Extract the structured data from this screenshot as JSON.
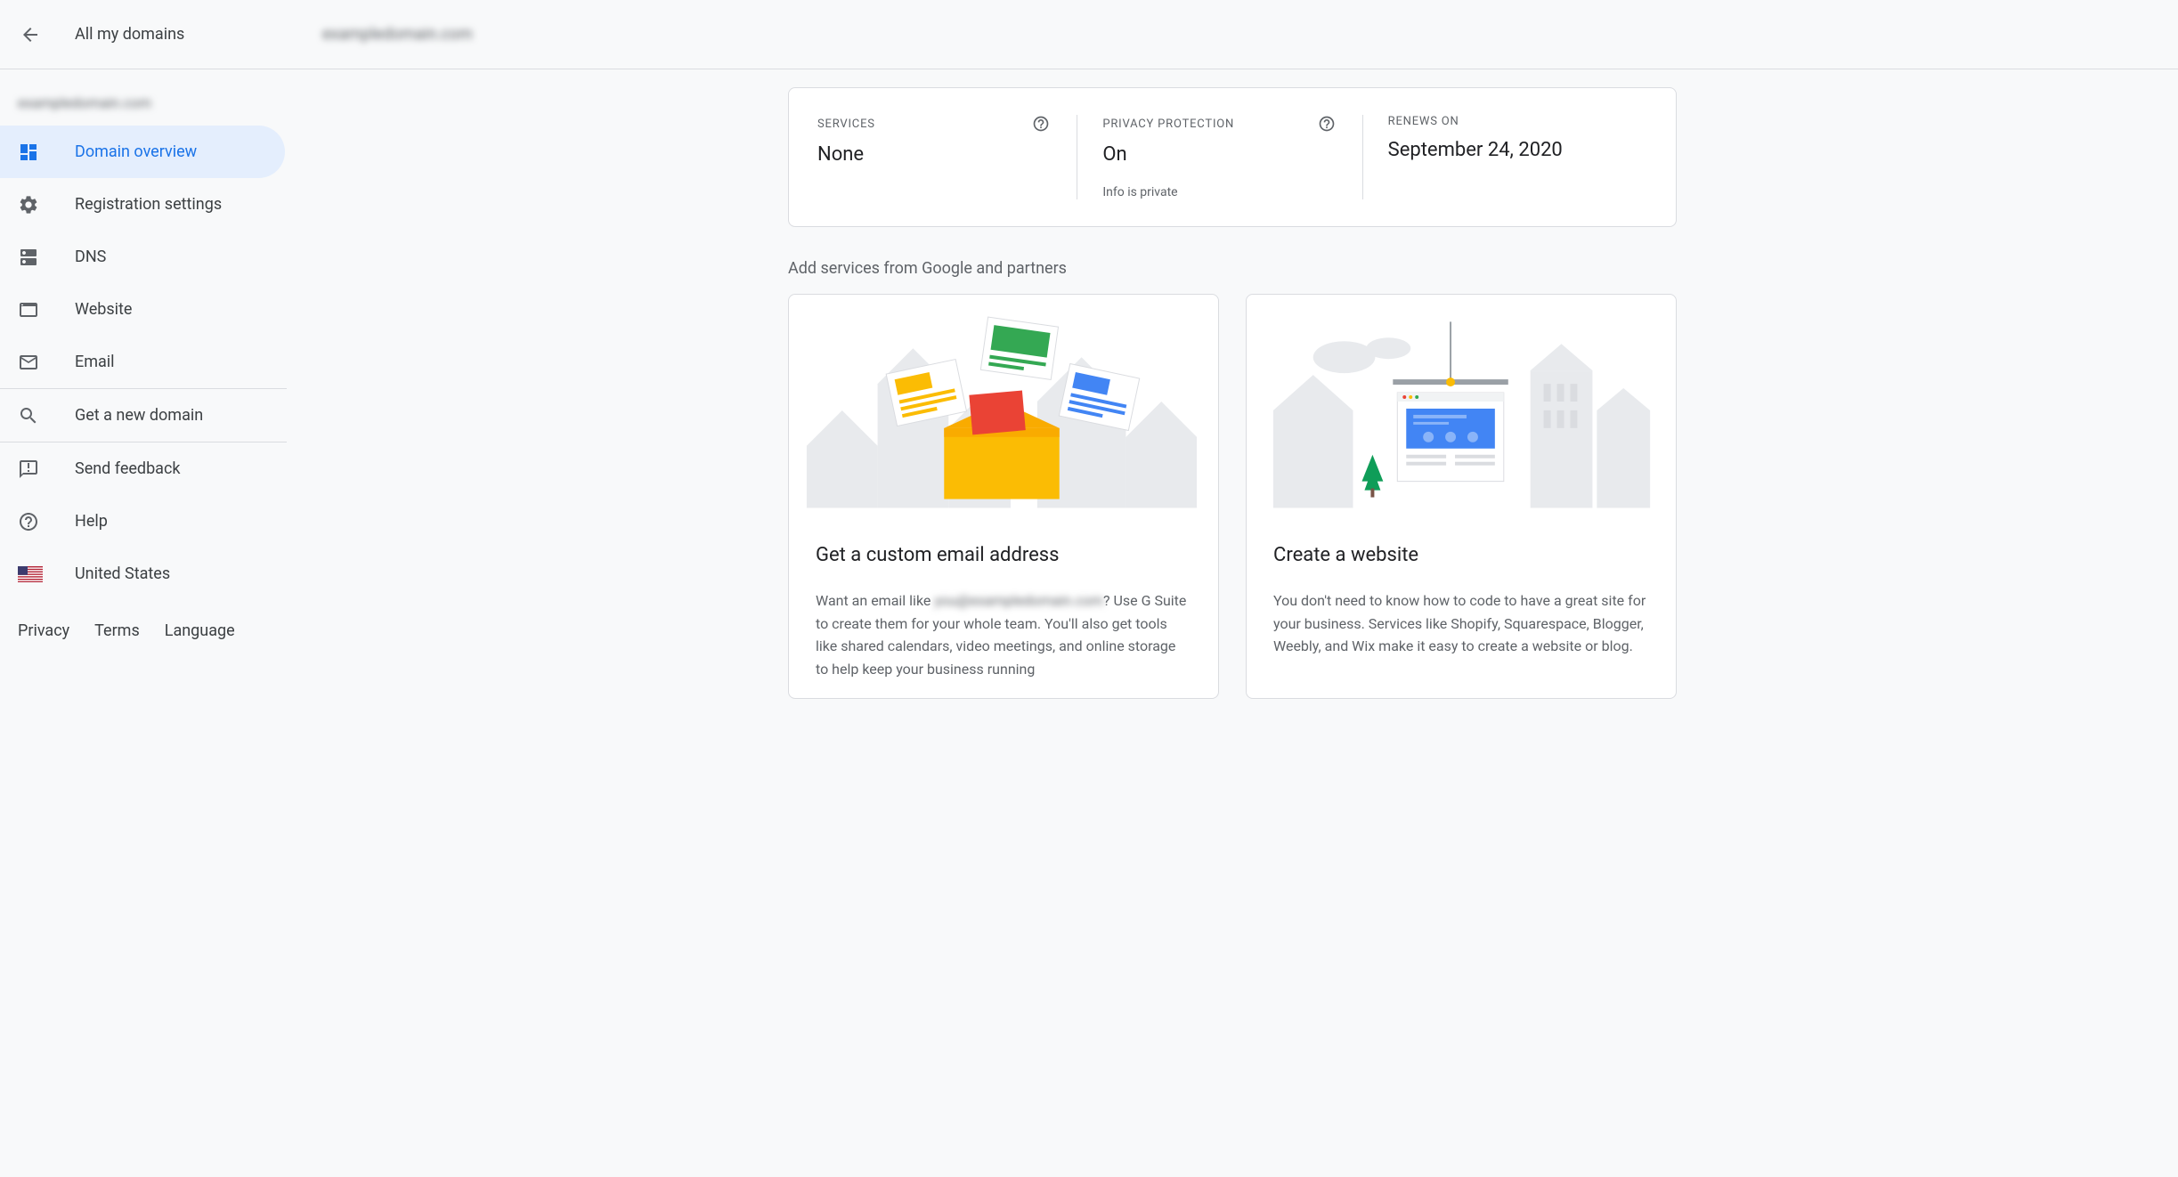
{
  "header": {
    "back_label": "All my domains",
    "domain_name": "exampledomain.com"
  },
  "sidebar": {
    "domain_name": "exampledomain.com",
    "items": [
      {
        "label": "Domain overview",
        "icon": "dashboard-icon"
      },
      {
        "label": "Registration settings",
        "icon": "gear-icon"
      },
      {
        "label": "DNS",
        "icon": "dns-icon"
      },
      {
        "label": "Website",
        "icon": "website-icon"
      },
      {
        "label": "Email",
        "icon": "email-icon"
      }
    ],
    "get_domain_label": "Get a new domain",
    "feedback_label": "Send feedback",
    "help_label": "Help",
    "locale_label": "United States"
  },
  "footer": {
    "privacy": "Privacy",
    "terms": "Terms",
    "language": "Language"
  },
  "status": {
    "services_label": "SERVICES",
    "services_value": "None",
    "privacy_label": "PRIVACY PROTECTION",
    "privacy_value": "On",
    "privacy_sub": "Info is private",
    "renews_label": "RENEWS ON",
    "renews_value": "September 24, 2020"
  },
  "services_heading": "Add services from Google and partners",
  "cards": {
    "email": {
      "title": "Get a custom email address",
      "desc_pre": "Want an email like ",
      "desc_blur": "you@exampledomain.com",
      "desc_post": "? Use G Suite to create them for your whole team. You'll also get tools like shared calendars, video meetings, and online storage to help keep your business running"
    },
    "website": {
      "title": "Create a website",
      "desc": "You don't need to know how to code to have a great site for your business. Services like Shopify, Squarespace, Blogger, Weebly, and Wix make it easy to create a website or blog."
    }
  }
}
